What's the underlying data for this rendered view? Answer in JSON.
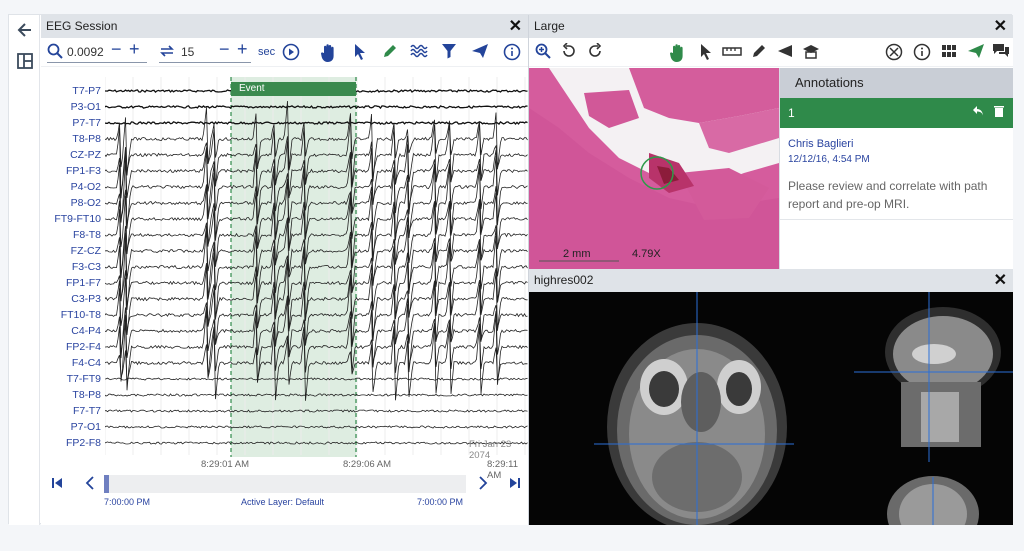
{
  "app": {
    "nav": {
      "back_icon": "arrow-left-icon",
      "layout_icon": "layout-icon"
    }
  },
  "eeg": {
    "title": "EEG Session",
    "zoom_value": "0.0092",
    "duration_value": "15",
    "duration_unit": "sec",
    "event_label": "Event",
    "timestamp_overlay": "Fri Jan 23 2074",
    "channels": [
      "T7-P7",
      "P3-O1",
      "P7-T7",
      "T8-P8",
      "CZ-PZ",
      "FP1-F3",
      "P4-O2",
      "P8-O2",
      "FT9-FT10",
      "F8-T8",
      "FZ-CZ",
      "F3-C3",
      "FP1-F7",
      "C3-P3",
      "FT10-T8",
      "C4-P4",
      "FP2-F4",
      "F4-C4",
      "T7-FT9",
      "T8-P8",
      "F7-T7",
      "P7-O1",
      "FP2-F8"
    ],
    "time_ticks": [
      "8:29:01 AM",
      "8:29:06 AM",
      "8:29:11 AM"
    ],
    "timeline_start": "7:00:00 PM",
    "timeline_end": "7:00:00 PM",
    "active_layer": "Active Layer: Default",
    "colors": {
      "accent": "#2f8a4a",
      "event_fill": "#d6e9d9",
      "label": "#2a44a0"
    }
  },
  "pathology": {
    "title": "Large",
    "scale_text": "2 mm",
    "zoom_text": "4.79X",
    "annotations_title": "Annotations",
    "annotation": {
      "number": "1",
      "author": "Chris Baglieri",
      "date": "12/12/16, 4:54 PM",
      "text": "Please review and correlate with path report and pre-op MRI."
    }
  },
  "mri": {
    "title": "highres002"
  }
}
